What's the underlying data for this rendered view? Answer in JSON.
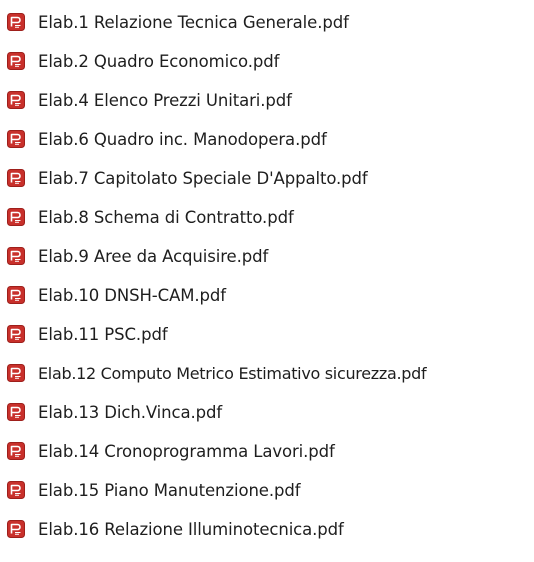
{
  "files": [
    {
      "name": "Elab.1 Relazione Tecnica Generale.pdf",
      "icon": "pdf-file-icon"
    },
    {
      "name": "Elab.2 Quadro Economico.pdf",
      "icon": "pdf-file-icon"
    },
    {
      "name": "Elab.4 Elenco Prezzi Unitari.pdf",
      "icon": "pdf-file-icon"
    },
    {
      "name": "Elab.6 Quadro inc. Manodopera.pdf",
      "icon": "pdf-file-icon"
    },
    {
      "name": "Elab.7 Capitolato Speciale D'Appalto.pdf",
      "icon": "pdf-file-icon"
    },
    {
      "name": "Elab.8 Schema di Contratto.pdf",
      "icon": "pdf-file-icon"
    },
    {
      "name": "Elab.9 Aree da Acquisire.pdf",
      "icon": "pdf-file-icon"
    },
    {
      "name": "Elab.10 DNSH-CAM.pdf",
      "icon": "pdf-file-icon"
    },
    {
      "name": "Elab.11 PSC.pdf",
      "icon": "pdf-file-icon"
    },
    {
      "name": "Elab.12 Computo Metrico Estimativo sicurezza.pdf",
      "icon": "pdf-file-icon"
    },
    {
      "name": "Elab.13 Dich.Vinca.pdf",
      "icon": "pdf-file-icon"
    },
    {
      "name": "Elab.14 Cronoprogramma Lavori.pdf",
      "icon": "pdf-file-icon"
    },
    {
      "name": "Elab.15 Piano Manutenzione.pdf",
      "icon": "pdf-file-icon"
    },
    {
      "name": "Elab.16 Relazione Illuminotecnica.pdf",
      "icon": "pdf-file-icon"
    }
  ],
  "colors": {
    "icon_red": "#c8302b",
    "icon_red_dark": "#9e1f1b",
    "text": "#1e1e1e",
    "background": "#ffffff"
  }
}
